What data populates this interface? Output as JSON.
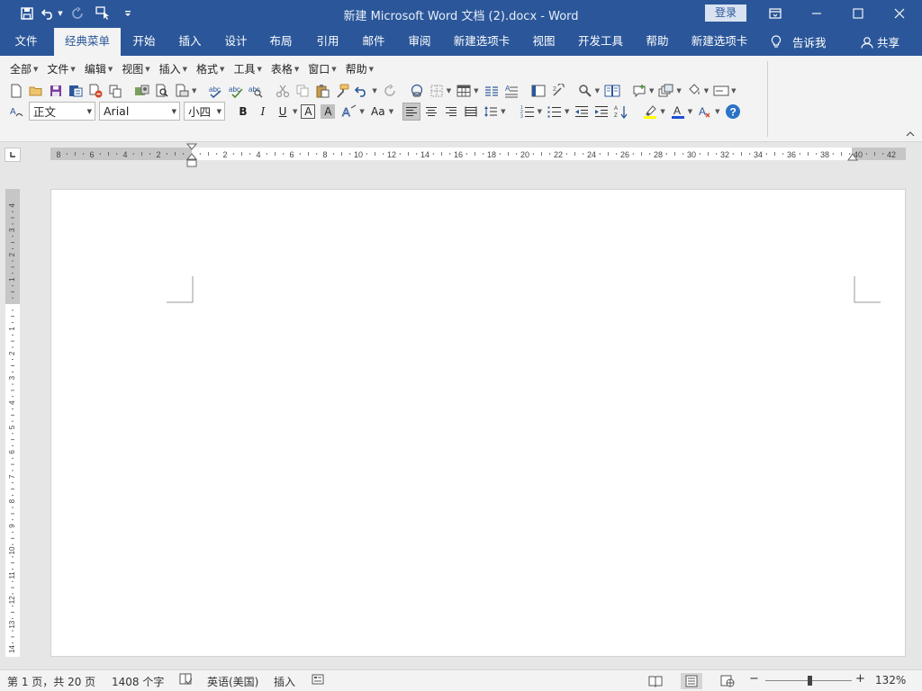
{
  "window": {
    "title": "新建 Microsoft Word 文档 (2).docx  -  Word",
    "login_label": "登录"
  },
  "tabs": [
    {
      "label": "文件",
      "active": false
    },
    {
      "label": "经典菜单",
      "active": true
    },
    {
      "label": "开始",
      "active": false
    },
    {
      "label": "插入",
      "active": false
    },
    {
      "label": "设计",
      "active": false
    },
    {
      "label": "布局",
      "active": false
    },
    {
      "label": "引用",
      "active": false
    },
    {
      "label": "邮件",
      "active": false
    },
    {
      "label": "审阅",
      "active": false
    },
    {
      "label": "新建选项卡",
      "active": false
    },
    {
      "label": "视图",
      "active": false
    },
    {
      "label": "开发工具",
      "active": false
    },
    {
      "label": "帮助",
      "active": false
    },
    {
      "label": "新建选项卡",
      "active": false
    }
  ],
  "tell_me": "告诉我",
  "share": "共享",
  "classic_menus": [
    "全部",
    "文件",
    "编辑",
    "视图",
    "插入",
    "格式",
    "工具",
    "表格",
    "窗口",
    "帮助"
  ],
  "formatting": {
    "style": "正文",
    "font": "Arial",
    "size": "小四",
    "bold": "B",
    "italic": "I",
    "underline": "U",
    "char_border": "A",
    "char_shading": "A",
    "change_case": "Aa"
  },
  "hruler": {
    "labels": [
      "8",
      "6",
      "4",
      "2",
      "",
      "2",
      "4",
      "6",
      "8",
      "10",
      "12",
      "14",
      "16",
      "18",
      "20",
      "22",
      "24",
      "26",
      "28",
      "30",
      "32",
      "34",
      "36",
      "38",
      "40",
      "42"
    ]
  },
  "vruler": {
    "labels": [
      "4",
      "3",
      "2",
      "1",
      "",
      "1",
      "2",
      "3",
      "4",
      "5",
      "6",
      "7",
      "8",
      "9",
      "10",
      "11",
      "12",
      "13",
      "14"
    ]
  },
  "status": {
    "page": "第 1 页，共 20 页",
    "words": "1408 个字",
    "language": "英语(美国)",
    "mode": "插入",
    "zoom": "132%",
    "zoom_minus": "−",
    "zoom_plus": "+"
  },
  "colors": {
    "brand": "#2b579a",
    "highlight": "#ffff00",
    "font_color": "#1f4fcf",
    "help": "#2b73c7"
  }
}
